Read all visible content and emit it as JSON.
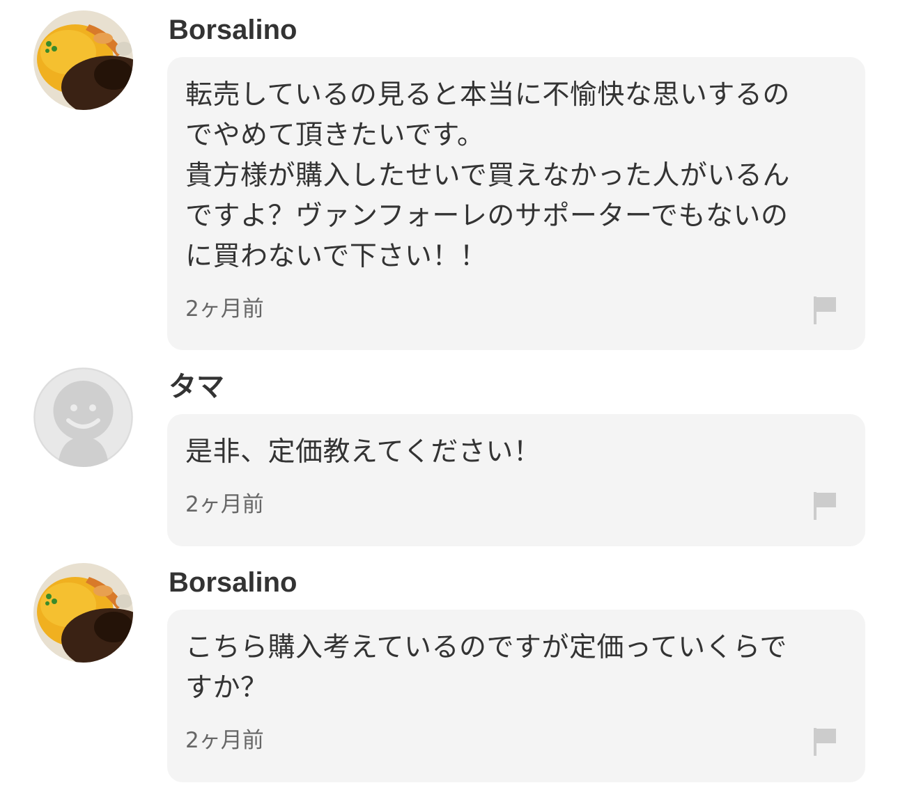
{
  "comments": [
    {
      "user": "Borsalino",
      "avatar": "curry-omurice-photo",
      "text": "転売しているの見ると本当に不愉快な思いするの\nでやめて頂きたいです。\n貴方様が購入したせいで買えなかった人がいるん\nですよ？ヴァンフォーレのサポーターでもないの\nに買わないで下さい！！",
      "time": "2ヶ月前",
      "flag_icon": "flag-icon"
    },
    {
      "user": "タマ",
      "avatar": "default-user-avatar",
      "text": "是非、定価教えてください！",
      "time": "2ヶ月前",
      "flag_icon": "flag-icon"
    },
    {
      "user": "Borsalino",
      "avatar": "curry-omurice-photo",
      "text": "こちら購入考えているのですが定価っていくらで\nすか？",
      "time": "2ヶ月前",
      "flag_icon": "flag-icon"
    }
  ],
  "colors": {
    "bubble_bg": "#f4f4f4",
    "text": "#333333",
    "timestamp": "#666666",
    "flag": "#cccccc"
  }
}
